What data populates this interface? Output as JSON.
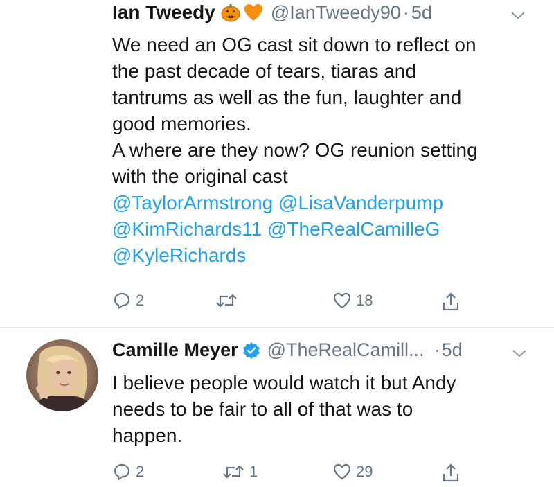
{
  "tweets": [
    {
      "name": "Ian Tweedy",
      "handle": "@IanTweedy90",
      "separator": "·",
      "time": "5d",
      "emojis": [
        "jack-o-lantern-icon",
        "orange-heart-icon"
      ],
      "lines": [
        "We need an OG cast sit down to reflect on",
        "the past decade of tears, tiaras and",
        "tantrums as well as the fun, laughter and",
        "good memories.",
        "A where are they now? OG reunion setting",
        "with the original cast"
      ],
      "mention_lines": [
        [
          "@TaylorArmstrong",
          "@LisaVanderpump"
        ],
        [
          "@KimRichards11",
          "@TheRealCamilleG"
        ],
        [
          "@KyleRichards"
        ]
      ],
      "actions": {
        "replies": "2",
        "retweets": "",
        "likes": "18"
      }
    },
    {
      "name": "Camille Meyer",
      "handle": "@TheRealCamill...",
      "separator": "·",
      "time": "5d",
      "verified": true,
      "lines": [
        "I believe people would watch it but Andy",
        "needs to be fair to all of that was to",
        "happen."
      ],
      "actions": {
        "replies": "2",
        "retweets": "1",
        "likes": "29"
      }
    }
  ],
  "colors": {
    "text": "#14171a",
    "secondary": "#657786",
    "link": "#1da1f2",
    "verified": "#1da1f2",
    "divider": "#e1e8ed"
  }
}
